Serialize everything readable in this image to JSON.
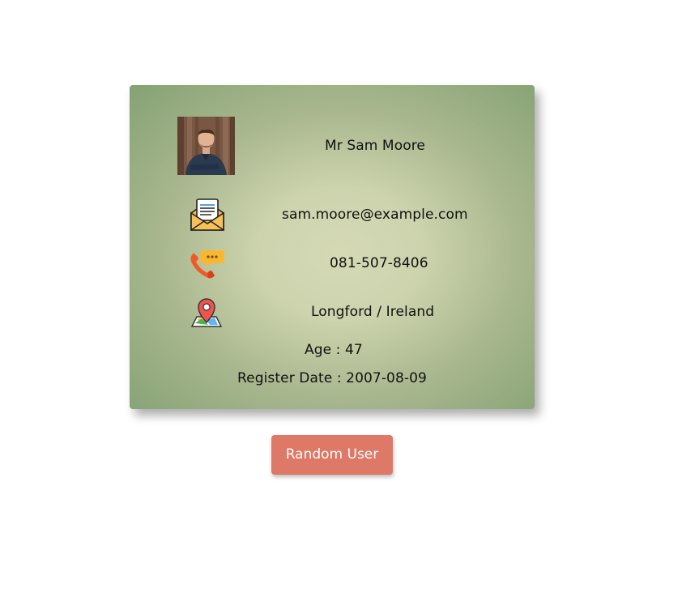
{
  "user": {
    "name": "Mr Sam Moore",
    "email": "sam.moore@example.com",
    "phone": "081-507-8406",
    "location": "Longford / Ireland",
    "age": "Age : 47",
    "register_date": "Register Date : 2007-08-09"
  },
  "icons": {
    "avatar": "user-photo",
    "email": "envelope-letter-icon",
    "phone": "phone-chat-icon",
    "location": "map-pin-icon"
  },
  "button": {
    "label": "Random User"
  },
  "colors": {
    "button": "#dd7966",
    "card_center": "#d5dab5",
    "card_edge": "#84a273"
  }
}
